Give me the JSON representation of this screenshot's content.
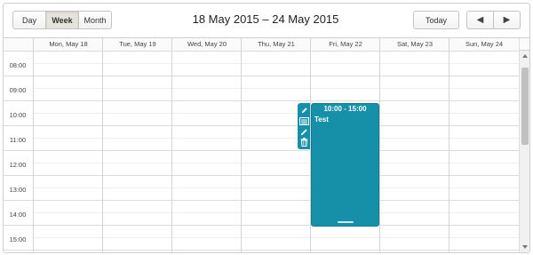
{
  "header": {
    "views": [
      {
        "label": "Day",
        "active": false
      },
      {
        "label": "Week",
        "active": true
      },
      {
        "label": "Month",
        "active": false
      }
    ],
    "title": "18 May 2015 – 24 May 2015",
    "today_label": "Today",
    "prev_icon": "prev-arrow-icon",
    "next_icon": "next-arrow-icon"
  },
  "days": [
    "Mon, May 18",
    "Tue, May 19",
    "Wed, May 20",
    "Thu, May 21",
    "Fri, May 22",
    "Sat, May 23",
    "Sun, May 24"
  ],
  "times": [
    "08:00",
    "09:00",
    "10:00",
    "11:00",
    "12:00",
    "13:00",
    "14:00",
    "15:00"
  ],
  "event": {
    "time_range": "10:00 - 15:00",
    "text": "Test",
    "color": "#1690a8",
    "toolbar_icons": [
      "pencil-icon",
      "details-icon",
      "edit-icon",
      "delete-icon"
    ]
  },
  "colors": {
    "event": "#1690a8",
    "active_view": "#e6e3dd"
  }
}
